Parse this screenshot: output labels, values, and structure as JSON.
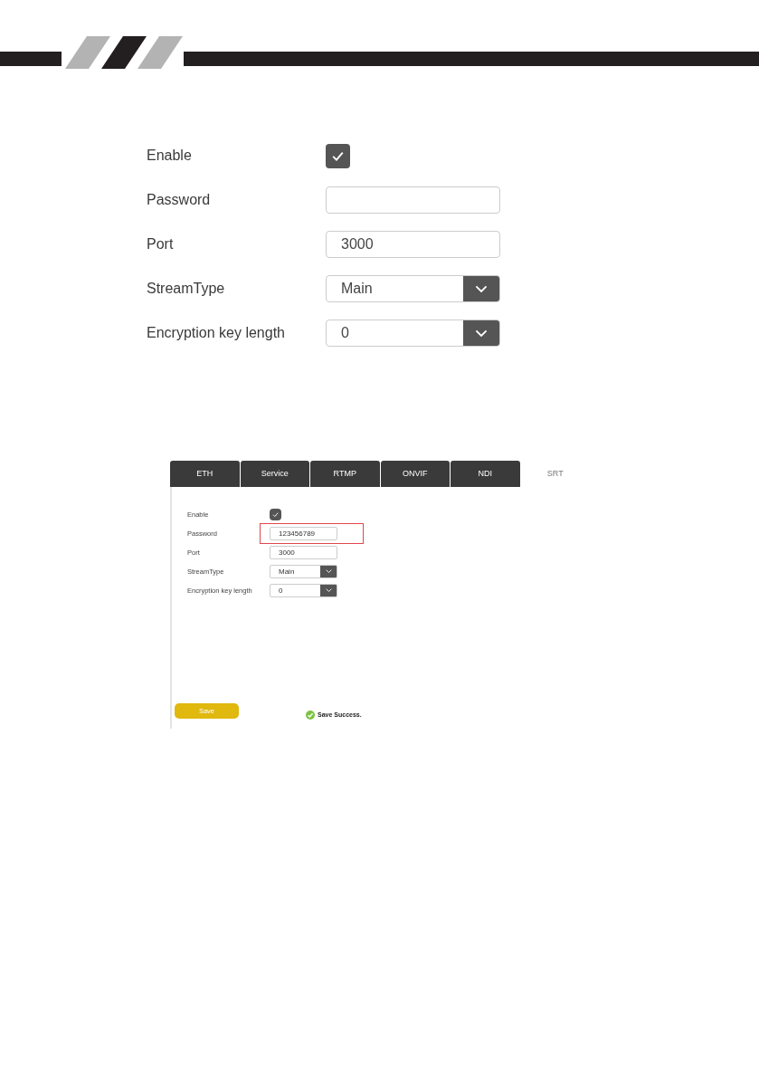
{
  "large_form": {
    "fields": [
      {
        "kind": "checkbox",
        "label": "Enable",
        "checked": true
      },
      {
        "kind": "text",
        "label": "Password"
      },
      {
        "kind": "text",
        "label": "Port",
        "value": "3000"
      },
      {
        "kind": "select",
        "label": "StreamType",
        "value": "Main"
      },
      {
        "kind": "select",
        "label": "Encryption key length",
        "value": "0"
      }
    ]
  },
  "screenshot": {
    "tabs": [
      {
        "label": "ETH",
        "selected": false
      },
      {
        "label": "Service",
        "selected": false
      },
      {
        "label": "RTMP",
        "selected": false
      },
      {
        "label": "ONVIF",
        "selected": false
      },
      {
        "label": "NDI",
        "selected": false
      },
      {
        "label": "SRT",
        "selected": true
      }
    ],
    "fields": [
      {
        "kind": "checkbox",
        "label": "Enable",
        "checked": true
      },
      {
        "kind": "text",
        "label": "Password",
        "value": "123456789",
        "highlighted": true
      },
      {
        "kind": "text",
        "label": "Port",
        "value": "3000",
        "highlighted": false
      },
      {
        "kind": "select",
        "label": "StreamType",
        "value": "Main"
      },
      {
        "kind": "select",
        "label": "Encryption key length",
        "value": "0"
      }
    ],
    "save_button": "Save",
    "status": "Save Success."
  }
}
